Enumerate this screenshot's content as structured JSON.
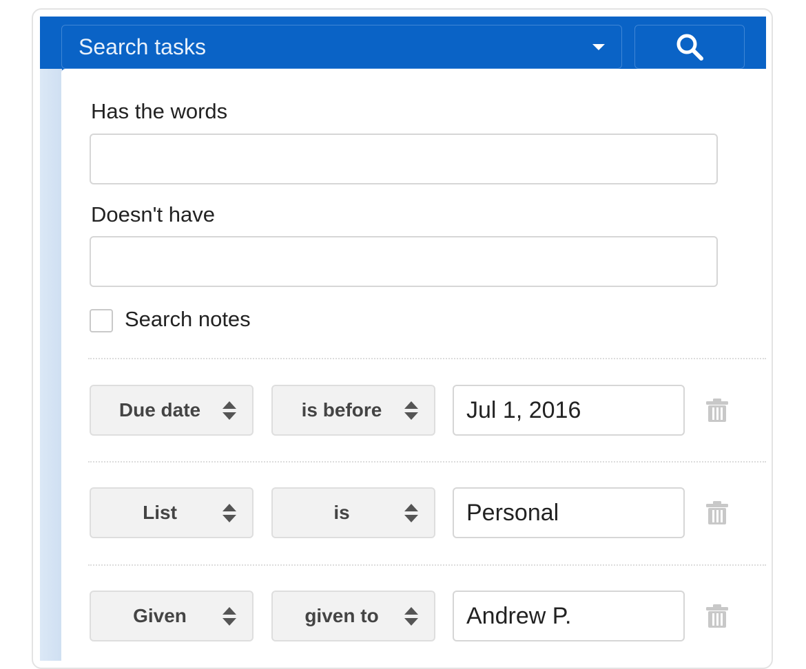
{
  "search": {
    "placeholder": "Search tasks",
    "button_icon": "search-icon"
  },
  "fields": {
    "has_words_label": "Has the words",
    "has_words_value": "",
    "doesnt_have_label": "Doesn't have",
    "doesnt_have_value": "",
    "search_notes_label": "Search notes",
    "search_notes_checked": false
  },
  "rules": [
    {
      "field": "Due date",
      "operator": "is before",
      "value": "Jul 1, 2016",
      "delete_icon": "trash-icon"
    },
    {
      "field": "List",
      "operator": "is",
      "value": "Personal",
      "delete_icon": "trash-icon"
    },
    {
      "field": "Given",
      "operator": "given to",
      "value": "Andrew P.",
      "delete_icon": "trash-icon"
    }
  ],
  "colors": {
    "header_blue": "#0a63c6",
    "select_bg": "#f2f2f2",
    "trash_gray": "#c8c8c8"
  }
}
